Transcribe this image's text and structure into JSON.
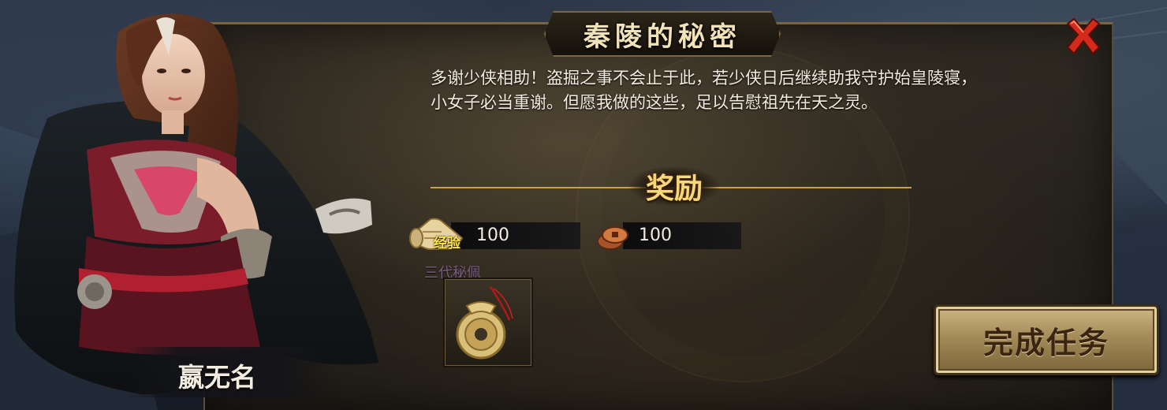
{
  "dialog": {
    "title": "秦陵的秘密",
    "message": "多谢少侠相助！盗掘之事不会止于此，若少侠日后继续助我守护始皇陵寝，小女子必当重谢。但愿我做的这些，足以告慰祖先在天之灵。"
  },
  "npc": {
    "name": "嬴无名"
  },
  "rewards": {
    "title": "奖励",
    "experience": {
      "label": "经验",
      "value": "100",
      "icon": "scroll-icon"
    },
    "coins": {
      "value": "100",
      "icon": "copper-coins-icon"
    },
    "item": {
      "name": "三代秘佩",
      "icon": "jade-pendant-icon"
    }
  },
  "actions": {
    "complete_label": "完成任务",
    "close_icon": "close-x-icon"
  },
  "colors": {
    "title_text": "#f2e2b8",
    "reward_title": "#f7d77a",
    "xp_label": "#ffe44a",
    "close_red": "#d42a1c",
    "button_gold": "#a48c5a"
  }
}
